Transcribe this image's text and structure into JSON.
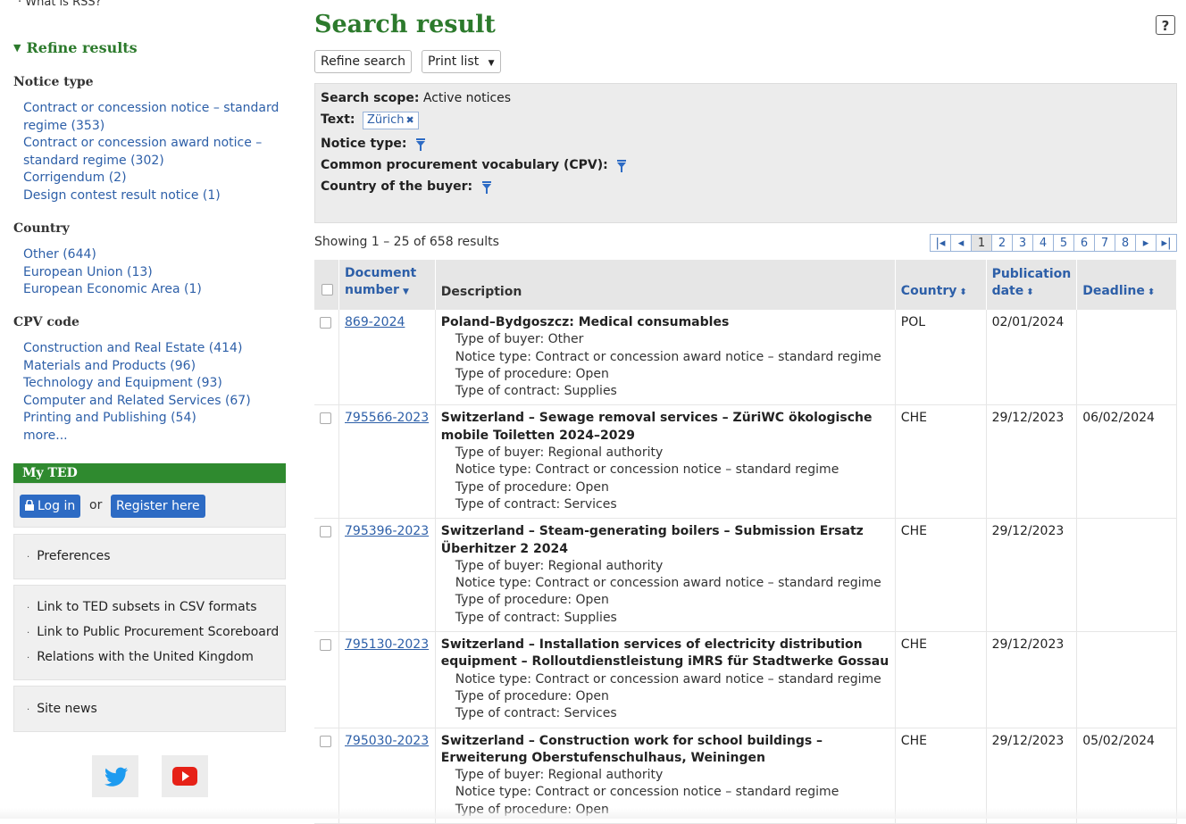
{
  "sidebar": {
    "top_cut_text": "· What is RSS?",
    "refine_title": "Refine results",
    "facets": [
      {
        "heading": "Notice type",
        "items": [
          "Contract or concession notice – standard regime (353)",
          "Contract or concession award notice – standard regime (302)",
          "Corrigendum (2)",
          "Design contest result notice (1)"
        ]
      },
      {
        "heading": "Country",
        "items": [
          "Other (644)",
          "European Union (13)",
          "European Economic Area (1)"
        ]
      },
      {
        "heading": "CPV code",
        "items": [
          "Construction and Real Estate (414)",
          "Materials and Products (96)",
          "Technology and Equipment (93)",
          "Computer and Related Services (67)",
          "Printing and Publishing (54)",
          "more..."
        ]
      }
    ],
    "myted_title": "My TED",
    "login_label": "Log in",
    "or_label": "or",
    "register_label": "Register here",
    "preferences_label": "Preferences",
    "links": [
      "Link to TED subsets in CSV formats",
      "Link to Public Procurement Scoreboard",
      "Relations with the United Kingdom"
    ],
    "site_news_label": "Site news",
    "social_icons": [
      "twitter-icon",
      "youtube-icon"
    ]
  },
  "main": {
    "title": "Search result",
    "help_label": "?",
    "refine_search_label": "Refine search",
    "print_list_label": "Print list",
    "scope": {
      "search_scope_label": "Search scope:",
      "search_scope_value": "Active notices",
      "text_label": "Text:",
      "text_tag": "Zürich",
      "notice_type_label": "Notice type:",
      "cpv_label": "Common procurement vocabulary (CPV):",
      "country_label": "Country of the buyer:"
    },
    "showing_text": "Showing 1 – 25 of 658 results",
    "pager": [
      "1",
      "2",
      "3",
      "4",
      "5",
      "6",
      "7",
      "8"
    ],
    "pager_current": "1",
    "table": {
      "headers": {
        "document": "Document number",
        "description": "Description",
        "country": "Country",
        "publication": "Publication date",
        "deadline": "Deadline"
      },
      "rows": [
        {
          "doc": "869-2024",
          "title": "Poland–Bydgoszcz: Medical consumables",
          "lines": [
            "Type of buyer: Other",
            "Notice type: Contract or concession award notice – standard regime",
            "Type of procedure: Open",
            "Type of contract: Supplies"
          ],
          "country": "POL",
          "pub": "02/01/2024",
          "deadline": ""
        },
        {
          "doc": "795566-2023",
          "title": "Switzerland – Sewage removal services – ZüriWC ökologische mobile Toiletten 2024–2029",
          "lines": [
            "Type of buyer: Regional authority",
            "Notice type: Contract or concession notice – standard regime",
            "Type of procedure: Open",
            "Type of contract: Services"
          ],
          "country": "CHE",
          "pub": "29/12/2023",
          "deadline": "06/02/2024"
        },
        {
          "doc": "795396-2023",
          "title": "Switzerland – Steam-generating boilers – Submission Ersatz Überhitzer 2 2024",
          "lines": [
            "Type of buyer: Regional authority",
            "Notice type: Contract or concession award notice – standard regime",
            "Type of procedure: Open",
            "Type of contract: Supplies"
          ],
          "country": "CHE",
          "pub": "29/12/2023",
          "deadline": ""
        },
        {
          "doc": "795130-2023",
          "title": "Switzerland – Installation services of electricity distribution equipment – Rolloutdienstleistung iMRS für Stadtwerke Gossau",
          "lines": [
            "Notice type: Contract or concession award notice – standard regime",
            "Type of procedure: Open",
            "Type of contract: Services"
          ],
          "country": "CHE",
          "pub": "29/12/2023",
          "deadline": ""
        },
        {
          "doc": "795030-2023",
          "title": "Switzerland – Construction work for school buildings – Erweiterung Oberstufenschulhaus, Weiningen",
          "lines": [
            "Type of buyer: Regional authority",
            "Notice type: Contract or concession notice – standard regime",
            "Type of procedure: Open"
          ],
          "country": "CHE",
          "pub": "29/12/2023",
          "deadline": "05/02/2024"
        }
      ]
    }
  }
}
